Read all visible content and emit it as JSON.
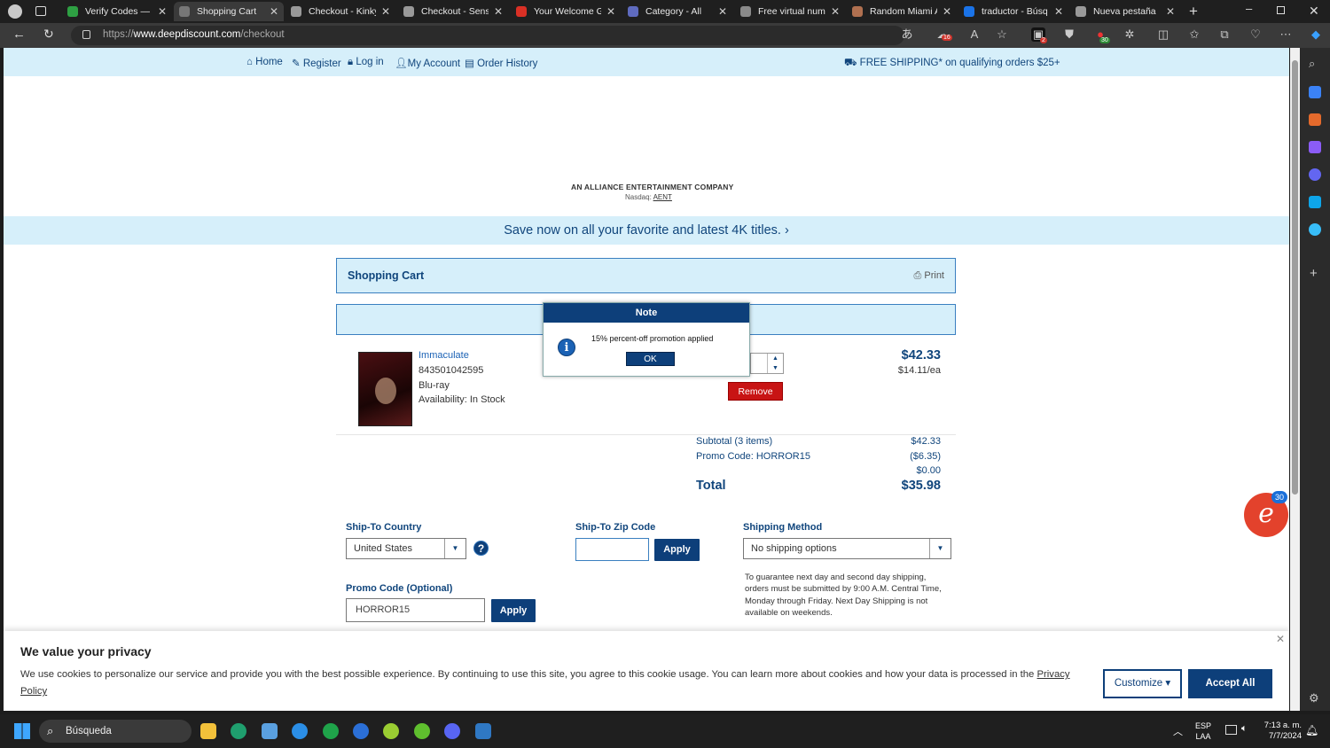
{
  "browser": {
    "tabs": [
      {
        "title": "Verify Codes — Si",
        "color": "#2ea043"
      },
      {
        "title": "Shopping Cart",
        "color": "#777777"
      },
      {
        "title": "Checkout - Kinky",
        "color": "#999999"
      },
      {
        "title": "Checkout - Senso",
        "color": "#999999"
      },
      {
        "title": "Your Welcome Gif",
        "color": "#d93025"
      },
      {
        "title": "Category - All",
        "color": "#5f6bbf"
      },
      {
        "title": "Free virtual numb",
        "color": "#8a8a8a"
      },
      {
        "title": "Random Miami A",
        "color": "#b07050"
      },
      {
        "title": "traductor - Búsq",
        "color": "#1a73e8"
      },
      {
        "title": "Nueva pestaña",
        "color": "#999999"
      }
    ],
    "url_prefix": "https://",
    "url_domain": "www.deepdiscount.com",
    "url_path": "/checkout",
    "ext_badges": {
      "shield": "16",
      "ext1": "2",
      "ext2": "30"
    }
  },
  "topnav": {
    "home": "Home",
    "register": "Register",
    "login": "Log in",
    "account": "My Account",
    "history": "Order History",
    "shipping": "FREE SHIPPING* on qualifying orders $25+"
  },
  "alliance": "AN ALLIANCE ENTERTAINMENT COMPANY",
  "nasdaq_label": "Nasdaq:",
  "nasdaq_ticker": "AENT",
  "promo_banner": "Save now on all your favorite and latest 4K titles.",
  "cart": {
    "title": "Shopping Cart",
    "print": "Print",
    "item": {
      "name": "Immaculate",
      "upc": "843501042595",
      "format": "Blu-ray",
      "availability": "Availability: In Stock",
      "price": "$42.33",
      "each": "$14.11/ea",
      "remove": "Remove"
    },
    "summary": [
      {
        "label": "Subtotal (3 items)",
        "value": "$42.33"
      },
      {
        "label": "Promo Code: HORROR15",
        "value": "($6.35)"
      },
      {
        "label": "",
        "value": "$0.00"
      }
    ],
    "total_label": "Total",
    "total_value": "$35.98",
    "ship_country_label": "Ship-To Country",
    "ship_country_value": "United States",
    "zip_label": "Ship-To Zip Code",
    "zip_apply": "Apply",
    "method_label": "Shipping Method",
    "method_value": "No shipping options",
    "promo_label": "Promo Code (Optional)",
    "promo_value": "HORROR15",
    "promo_apply": "Apply",
    "ship_note": "To guarantee next day and second day shipping, orders must be submitted by 9:00 A.M. Central Time, Monday through Friday. Next Day Shipping is not available on weekends."
  },
  "dialog": {
    "title": "Note",
    "message": "15% percent-off promotion applied",
    "ok": "OK"
  },
  "cookie": {
    "title": "We value your privacy",
    "text": "We use cookies to personalize our service and provide you with the best possible experience. By continuing to use this site, you agree to this cookie usage. You can learn more about cookies and how your data is processed in the ",
    "link": "Privacy Policy",
    "customize": "Customize",
    "accept": "Accept All"
  },
  "chat_badge": "30",
  "taskbar": {
    "search": "Búsqueda",
    "lang1": "ESP",
    "lang2": "LAA",
    "time": "7:13 a. m.",
    "date": "7/7/2024"
  },
  "colors": {
    "brand": "#0d3f7a",
    "light": "#d6effa",
    "remove": "#c81414"
  }
}
